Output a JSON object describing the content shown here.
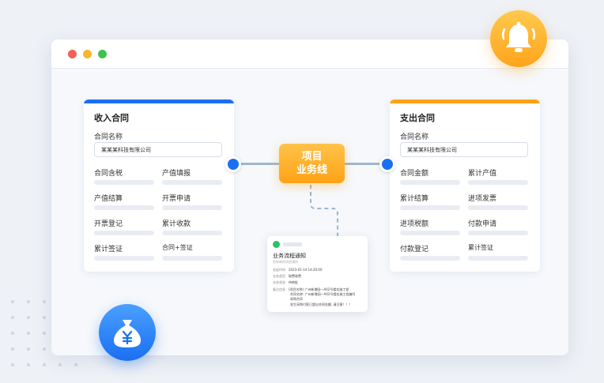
{
  "theme": {
    "income_accent": "#1a6ff2",
    "expense_accent": "#ffa316",
    "node_color": "#1a6ff2",
    "connector_color": "#9eb6cf"
  },
  "center": {
    "line1": "项目",
    "line2": "业务线"
  },
  "income_card": {
    "title": "收入合同",
    "field_label": "合同名称",
    "field_value": "某某某科技有限公司",
    "cells": [
      {
        "label": "合同含税"
      },
      {
        "label": "产值填报"
      },
      {
        "label": "产值结算"
      },
      {
        "label": "开票申请"
      },
      {
        "label": "开票登记"
      },
      {
        "label": "累计收款"
      },
      {
        "label": "累计签证"
      },
      {
        "label": "合同+签证"
      }
    ]
  },
  "expense_card": {
    "title": "支出合同",
    "field_label": "合同名称",
    "field_value": "某某某科技有限公司",
    "cells": [
      {
        "label": "合同金额"
      },
      {
        "label": "累计产值"
      },
      {
        "label": "累计结算"
      },
      {
        "label": "进项发票"
      },
      {
        "label": "进项税额"
      },
      {
        "label": "付款申请"
      },
      {
        "label": "付款登记"
      },
      {
        "label": "累计签证"
      }
    ]
  },
  "notice": {
    "title": "业务流程通知",
    "subtitle": "您有新的消息通知",
    "rows": [
      {
        "key": "发起时间",
        "value": "2023-01-14 14:20:00"
      },
      {
        "key": "业务类型",
        "value": "取费收费"
      },
      {
        "key": "业务状态",
        "value": "待审批"
      },
      {
        "key": "备注信息",
        "value": "(项目名称) 广州新增园—A02号楼实施工程"
      },
      {
        "key": "",
        "value": "合同名称: 广州新增园—A02号楼实施工程编号"
      },
      {
        "key": "",
        "value": "采购合同"
      },
      {
        "key": "",
        "value": "发生采购付款已超出合同金额, 请注意！！！"
      }
    ]
  },
  "icons": {
    "bell": "bell-icon",
    "money": "money-bag-icon",
    "wechat": "wechat-icon"
  }
}
